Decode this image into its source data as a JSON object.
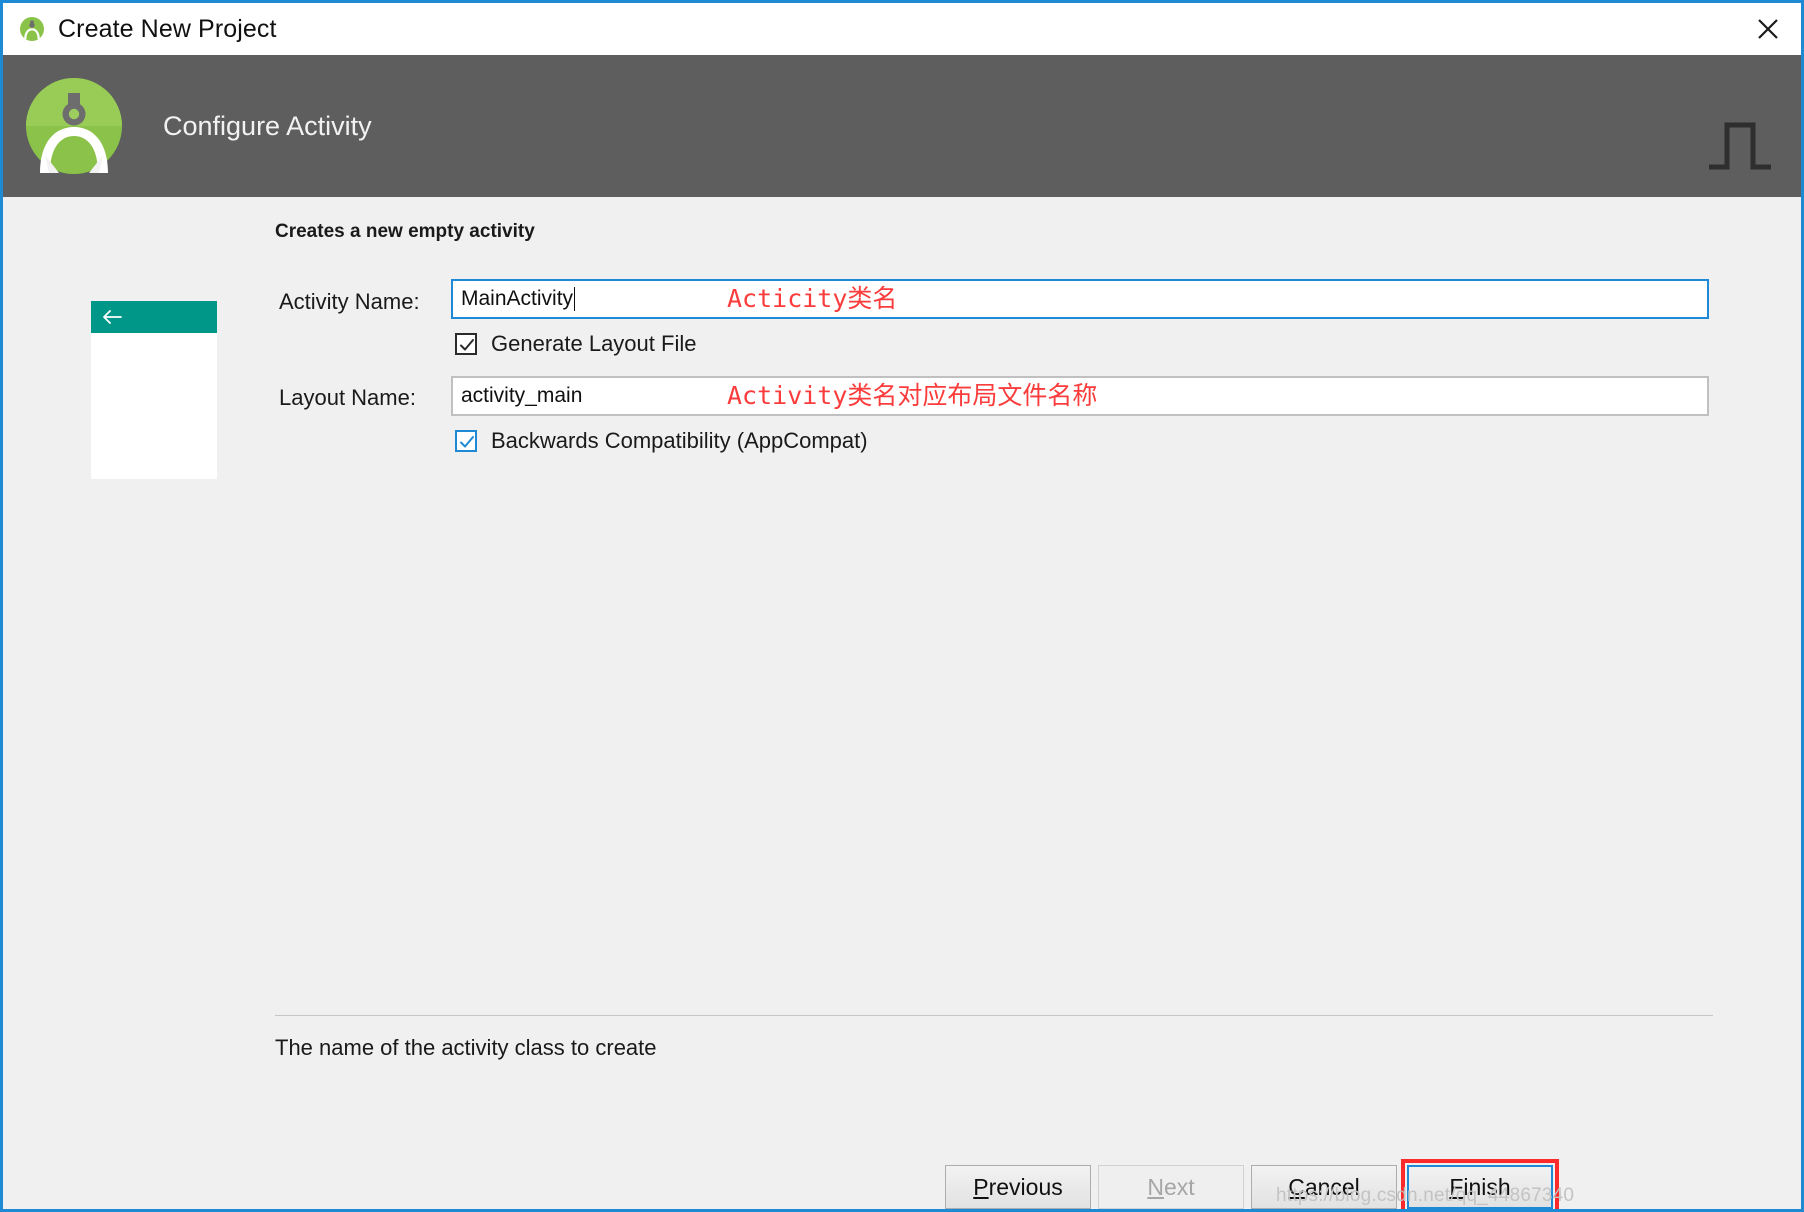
{
  "window": {
    "title": "Create New Project",
    "app_icon": "android-studio-icon",
    "close_icon": "close-icon"
  },
  "header": {
    "title": "Configure Activity",
    "logo_icon": "android-studio-logo",
    "decoration_icon": "square-wave-icon"
  },
  "main": {
    "caption": "Creates a new empty activity",
    "preview": {
      "back_icon": "back-arrow-icon",
      "appbar_color": "#009688"
    },
    "fields": [
      {
        "label": "Activity Name:",
        "value": "MainActivity",
        "focused": true,
        "annotation": "Acticity类名"
      },
      {
        "label": "Layout Name:",
        "value": "activity_main",
        "focused": false,
        "annotation": "Activity类名对应布局文件名称"
      }
    ],
    "checkboxes": [
      {
        "label": "Generate Layout File",
        "checked": true,
        "style": "dark"
      },
      {
        "label": "Backwards Compatibility (AppCompat)",
        "checked": true,
        "style": "blue"
      }
    ],
    "help_text": "The name of the activity class to create"
  },
  "footer": {
    "buttons": [
      {
        "label": "Previous",
        "mnemonic": "P",
        "rest": "revious",
        "state": "enabled"
      },
      {
        "label": "Next",
        "mnemonic": "N",
        "rest": "ext",
        "state": "disabled"
      },
      {
        "label": "Cancel",
        "mnemonic": "C",
        "rest": "ancel",
        "state": "enabled"
      },
      {
        "label": "Finish",
        "mnemonic": "F",
        "rest": "inish",
        "state": "focused"
      }
    ]
  },
  "watermark": "https://blog.csdn.net/qq_44867340",
  "colors": {
    "dialog_border": "#1e8ad6",
    "header_band": "#5e5e5e",
    "body": "#f0f0f0",
    "accent_blue": "#1e8ad6",
    "annotation_red": "#fa3c3c",
    "highlight_red": "#fb2b2b",
    "teal": "#009688",
    "android_green": "#7fc24a"
  }
}
